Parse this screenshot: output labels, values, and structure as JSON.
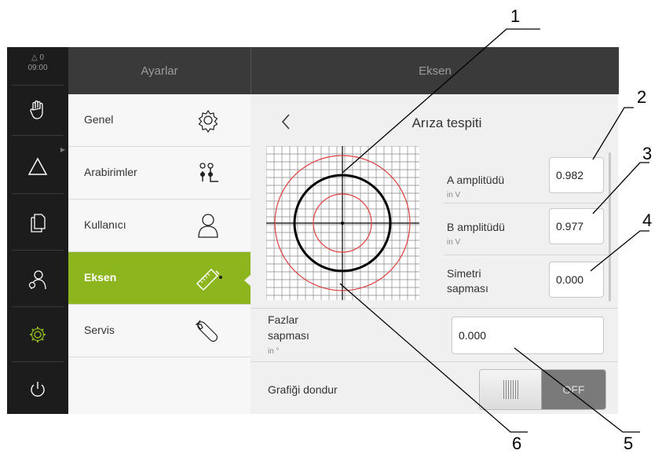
{
  "status": {
    "warning_count": "0",
    "time": "09:00"
  },
  "sidebar": {
    "icons": [
      "hand-icon",
      "triangle-icon",
      "documents-icon",
      "user-settings-icon",
      "gear-icon",
      "power-icon"
    ]
  },
  "menu_header": "Ayarlar",
  "menu": [
    {
      "label": "Genel",
      "icon": "gear-icon"
    },
    {
      "label": "Arabirimler",
      "icon": "interfaces-icon"
    },
    {
      "label": "Kullanıcı",
      "icon": "user-icon"
    },
    {
      "label": "Eksen",
      "icon": "encoder-icon",
      "active": true
    },
    {
      "label": "Servis",
      "icon": "wrench-icon"
    }
  ],
  "content_header": "Eksen",
  "page": {
    "title": "Arıza tespiti",
    "back_icon": "chevron-left-icon"
  },
  "fields": {
    "a_amp": {
      "label": "A amplitüdü",
      "unit": "in V",
      "value": "0.982"
    },
    "b_amp": {
      "label": "B amplitüdü",
      "unit": "in V",
      "value": "0.977"
    },
    "sym": {
      "label1": "Simetri",
      "label2": "sapması",
      "value": "0.000"
    },
    "phase": {
      "label1": "Fazlar",
      "label2": "sapması",
      "unit": "in °",
      "value": "0.000"
    },
    "freeze": {
      "label": "Grafiği dondur",
      "toggle": "OFF"
    }
  },
  "callouts": [
    "1",
    "2",
    "3",
    "4",
    "5",
    "6"
  ],
  "colors": {
    "accent": "#8cb51e",
    "sidebar": "#1c1c1c",
    "header": "#3a3a3a",
    "circle_red": "#e04040"
  }
}
